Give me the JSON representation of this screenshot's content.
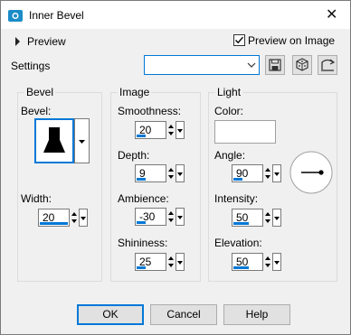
{
  "window": {
    "title": "Inner Bevel",
    "close_glyph": "✕"
  },
  "preview": {
    "label": "Preview",
    "preview_on_image_label": "Preview on Image",
    "preview_on_image_checked": true
  },
  "settings": {
    "label": "Settings",
    "preset_value": "",
    "icons": [
      "save-preset-icon",
      "reset-dice-icon",
      "edit-preset-icon"
    ]
  },
  "bevel_group": {
    "title": "Bevel",
    "bevel_label": "Bevel:",
    "width_label": "Width:",
    "width_value": "20",
    "width_fraction": 0.95
  },
  "image_group": {
    "title": "Image",
    "smoothness_label": "Smoothness:",
    "smoothness_value": "20",
    "smoothness_fraction": 0.3,
    "depth_label": "Depth:",
    "depth_value": "9",
    "depth_fraction": 0.3,
    "ambience_label": "Ambience:",
    "ambience_value": "-30",
    "ambience_fraction": 0.3,
    "shininess_label": "Shininess:",
    "shininess_value": "25",
    "shininess_fraction": 0.3
  },
  "light_group": {
    "title": "Light",
    "color_label": "Color:",
    "color_value": "#ffffff",
    "angle_label": "Angle:",
    "angle_value": "90",
    "angle_fraction": 0.3,
    "intensity_label": "Intensity:",
    "intensity_value": "50",
    "intensity_fraction": 0.5,
    "elevation_label": "Elevation:",
    "elevation_value": "50",
    "elevation_fraction": 0.5
  },
  "buttons": {
    "ok": "OK",
    "cancel": "Cancel",
    "help": "Help"
  },
  "colors": {
    "accent": "#0078d7",
    "dialog_bg": "#f0f0f0",
    "app_icon": "#1a8cc8"
  }
}
